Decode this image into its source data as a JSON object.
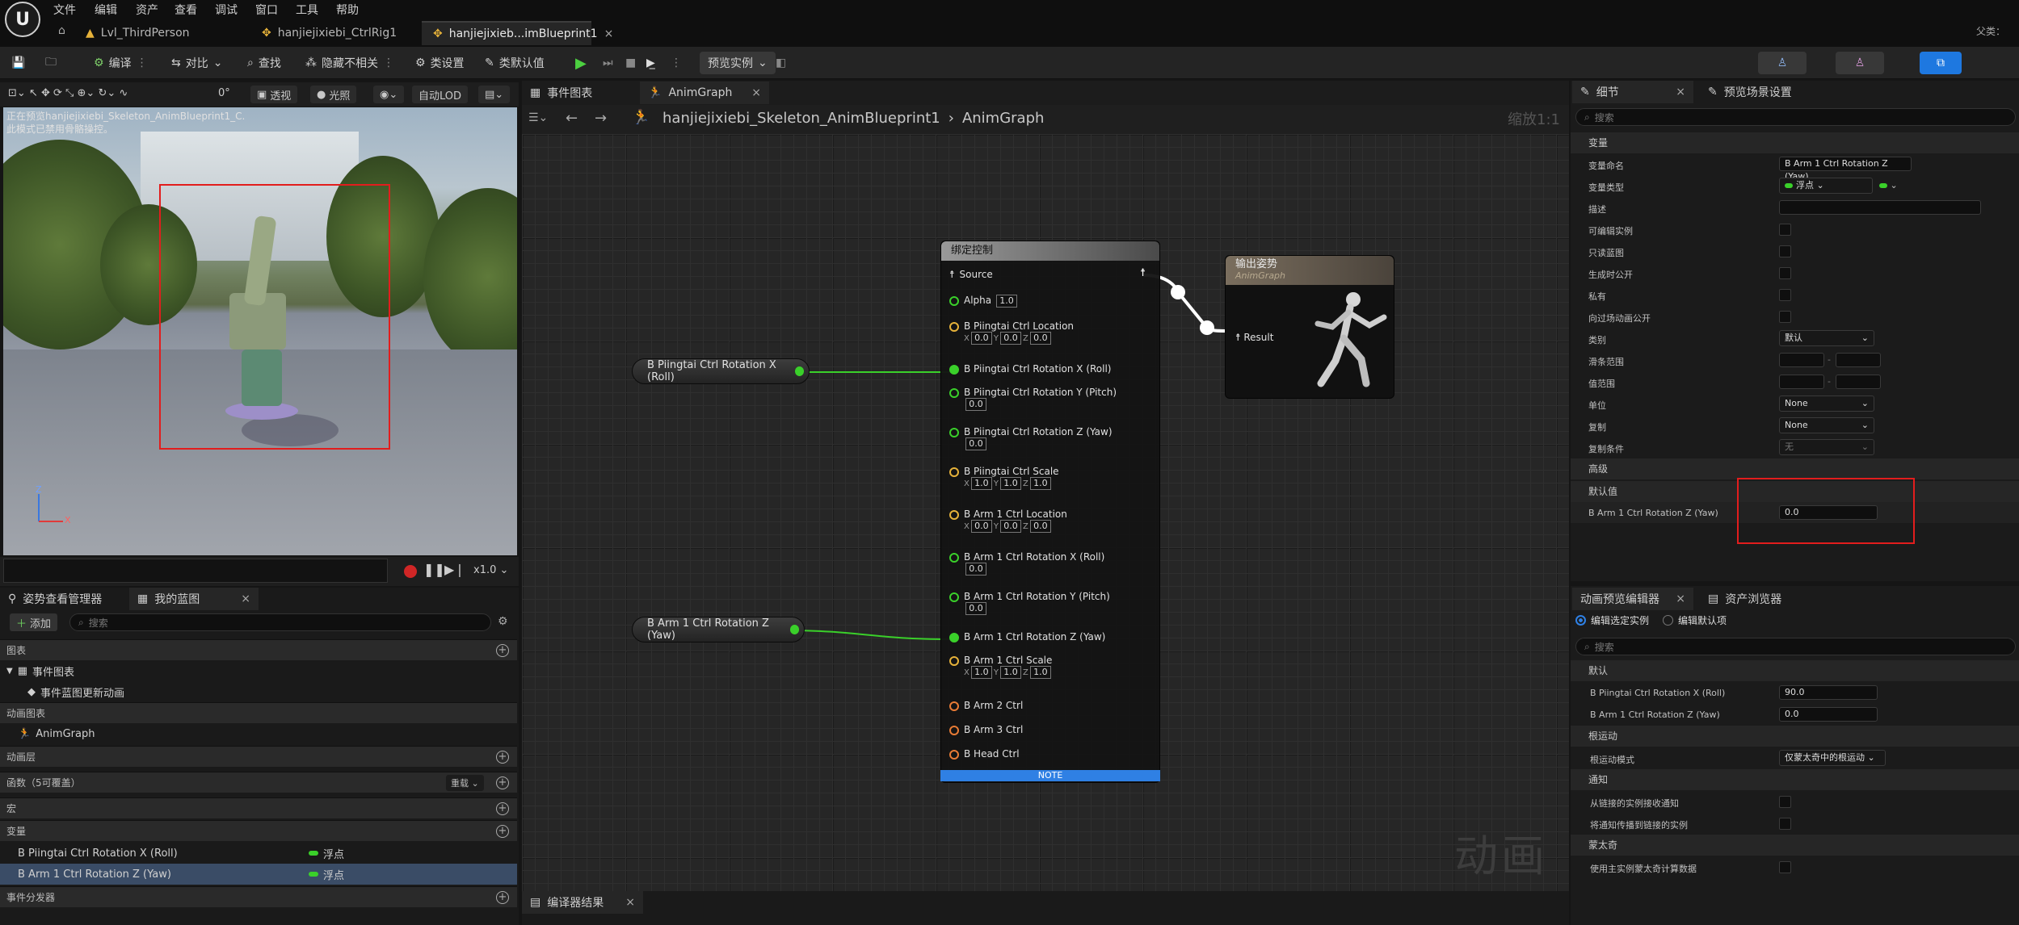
{
  "menu": [
    "文件",
    "编辑",
    "资产",
    "查看",
    "调试",
    "窗口",
    "工具",
    "帮助"
  ],
  "doc_tabs": [
    "Lvl_ThirdPerson",
    "hanjiejixiebi_CtrlRig1",
    "hanjiejixieb...imBlueprint1"
  ],
  "top_right_label": "父类：",
  "toolbar": {
    "compile": "编译",
    "diff": "对比",
    "find": "查找",
    "hide_unrelated": "隐藏不相关",
    "class_settings": "类设置",
    "class_defaults": "类默认值",
    "preview_instance": "预览实例"
  },
  "viewport": {
    "view_mode": "透视",
    "lighting": "光照",
    "lod": "自动LOD",
    "angle": "0°",
    "message_line1": "正在预览hanjiejixiebi_Skeleton_AnimBlueprint1_C.",
    "message_line2": "此模式已禁用骨骼操控。",
    "axis_z": "Z",
    "axis_x": "X",
    "play_speed": "x1.0"
  },
  "left_panel": {
    "tab1": "姿势查看管理器",
    "tab2": "我的蓝图",
    "add_label": "添加",
    "search_placeholder": "搜索",
    "graphs_header": "图表",
    "event_graph": "事件图表",
    "event_update": "事件蓝图更新动画",
    "anim_graphs_header": "动画图表",
    "anim_graph": "AnimGraph",
    "anim_layers": "动画层",
    "functions": "函数（5可覆盖）",
    "override": "重载",
    "macros": "宏",
    "variables_header": "变量",
    "var1": "B Piingtai Ctrl Rotation X (Roll)",
    "var1_type": "浮点",
    "var2": "B Arm 1 Ctrl Rotation Z (Yaw)",
    "var2_type": "浮点",
    "dispatchers": "事件分发器"
  },
  "graph": {
    "tab1": "事件图表",
    "tab2": "AnimGraph",
    "breadcrumb_root": "hanjiejixiebi_Skeleton_AnimBlueprint1",
    "breadcrumb_leaf": "AnimGraph",
    "zoom_label": "缩放1:1",
    "watermark": "动画",
    "var_node1": "B Piingtai Ctrl Rotation X (Roll)",
    "var_node2": "B Arm 1 Ctrl Rotation Z (Yaw)",
    "control_node": {
      "title": "绑定控制",
      "source": "Source",
      "alpha_label": "Alpha",
      "alpha": "1.0",
      "p1": "B Piingtai Ctrl Location",
      "p2": "B Piingtai Ctrl Rotation X (Roll)",
      "p3": "B Piingtai Ctrl Rotation Y (Pitch)",
      "p4": "B Piingtai Ctrl Rotation Z (Yaw)",
      "p5": "B Piingtai Ctrl Scale",
      "p6": "B Arm 1 Ctrl Location",
      "p7": "B Arm 1 Ctrl Rotation X (Roll)",
      "p8": "B Arm 1 Ctrl Rotation Y (Pitch)",
      "p9": "B Arm 1 Ctrl Rotation Z (Yaw)",
      "p10": "B Arm 1 Ctrl Scale",
      "p11": "B Arm 2 Ctrl",
      "p12": "B Arm 3 Ctrl",
      "p13": "B Head Ctrl",
      "zero": "0.0",
      "one": "1.0",
      "x": "X",
      "y": "Y",
      "z": "Z",
      "note": "NOTE"
    },
    "output_node": {
      "title": "输出姿势",
      "subtitle": "AnimGraph",
      "result": "Result"
    },
    "compile_tab": "编译器结果"
  },
  "details": {
    "tab1": "细节",
    "tab2": "预览场景设置",
    "search_placeholder": "搜索",
    "section_variable": "变量",
    "rows": [
      {
        "label": "变量命名",
        "value": "B Arm 1 Ctrl Rotation Z (Yaw)"
      },
      {
        "label": "变量类型",
        "value": "浮点"
      },
      {
        "label": "描述",
        "value": ""
      },
      {
        "label": "可编辑实例",
        "value": ""
      },
      {
        "label": "只读蓝图",
        "value": ""
      },
      {
        "label": "生成时公开",
        "value": ""
      },
      {
        "label": "私有",
        "value": ""
      },
      {
        "label": "向过场动画公开",
        "value": ""
      },
      {
        "label": "类别",
        "value": "默认"
      },
      {
        "label": "滑条范围",
        "value": ""
      },
      {
        "label": "值范围",
        "value": ""
      },
      {
        "label": "单位",
        "value": "None"
      },
      {
        "label": "复制",
        "value": "None"
      },
      {
        "label": "复制条件",
        "value": "无"
      }
    ],
    "section_advanced": "高级",
    "section_default": "默认值",
    "default_label": "B Arm 1 Ctrl Rotation Z (Yaw)",
    "default_value": "0.0"
  },
  "anim_preview": {
    "tab1": "动画预览编辑器",
    "tab2": "资产浏览器",
    "radio1": "编辑选定实例",
    "radio2": "编辑默认项",
    "search_placeholder": "搜索",
    "sec_default": "默认",
    "r1_label": "B Piingtai Ctrl Rotation X (Roll)",
    "r1_value": "90.0",
    "r2_label": "B Arm 1 Ctrl Rotation Z (Yaw)",
    "r2_value": "0.0",
    "sec_root": "根运动",
    "root_mode_label": "根运动模式",
    "root_mode_value": "仅蒙太奇中的根运动",
    "sec_notify": "通知",
    "notify1": "从链接的实例接收通知",
    "notify2": "将通知传播到链接的实例",
    "sec_montage": "蒙太奇",
    "montage1": "使用主实例蒙太奇计算数据"
  },
  "colors": {
    "accent": "#2f80e4",
    "pin_float": "#3ad02a",
    "highlight": "#e21d1d"
  }
}
